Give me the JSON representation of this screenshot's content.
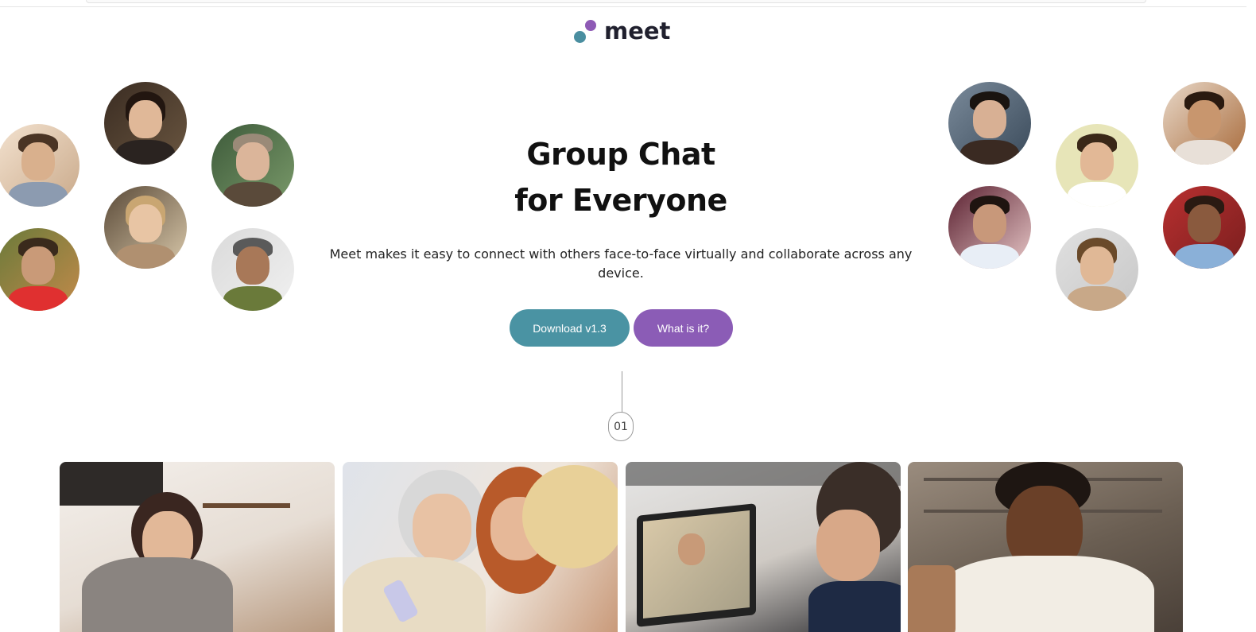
{
  "brand": {
    "name": "meet",
    "colors": {
      "teal": "#4a8ea0",
      "purple": "#8e5ab5"
    }
  },
  "hero": {
    "title_line1": "Group Chat",
    "title_line2": "for Everyone",
    "description": "Meet makes it easy to connect with others face-to-face virtually and collaborate across any device."
  },
  "buttons": {
    "download_label": "Download v1.3",
    "what_label": "What is it?"
  },
  "step": {
    "number": "01"
  },
  "accent_colors": {
    "download": "#4a93a3",
    "what": "#8b5cb6"
  },
  "photos": [
    {
      "icon": "woman-with-headphones-laughing-photo"
    },
    {
      "icon": "three-women-looking-at-phone-photo"
    },
    {
      "icon": "man-on-video-call-laptop-photo"
    },
    {
      "icon": "man-smiling-at-phone-photo"
    }
  ]
}
